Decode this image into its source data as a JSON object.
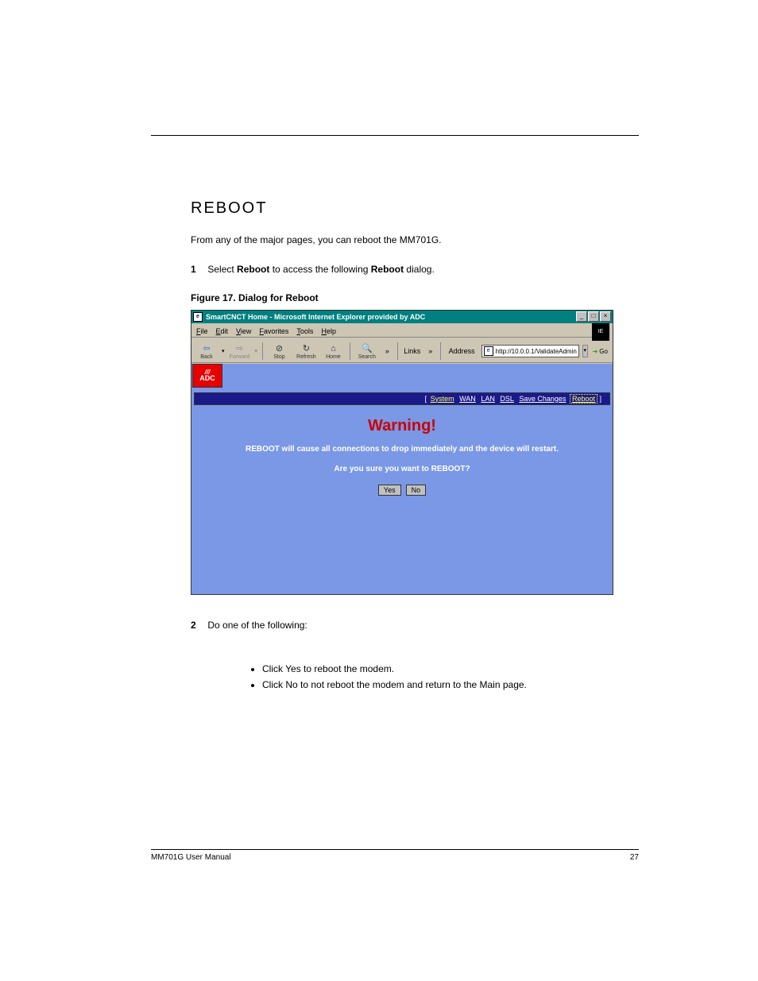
{
  "section_title": "REBOOT",
  "intro_line1": "From any of the major pages, you can reboot the MM701G.",
  "intro_step_prefix": "1",
  "intro_step_text_a": "Select ",
  "intro_step_bold": "Reboot",
  "intro_step_text_b": " to access the following ",
  "intro_step_bold2": "Reboot",
  "intro_step_text_c": " dialog.",
  "figure_caption": "Figure 17.  Dialog for Reboot",
  "browser": {
    "title": "SmartCNCT Home - Microsoft Internet Explorer provided by ADC",
    "menus": [
      "File",
      "Edit",
      "View",
      "Favorites",
      "Tools",
      "Help"
    ],
    "toolbar": {
      "back": "Back",
      "forward": "Forward",
      "stop": "Stop",
      "refresh": "Refresh",
      "home": "Home",
      "search": "Search"
    },
    "links_label": "Links",
    "address_label": "Address",
    "address_value": "http://10.0.0.1/ValidateAdmin",
    "go": "Go"
  },
  "adc_logo": "ADC",
  "nav": {
    "system": "System",
    "wan": "WAN",
    "lan": "LAN",
    "dsl": "DSL",
    "save": "Save Changes",
    "reboot": "Reboot"
  },
  "warning_title": "Warning!",
  "warning_text": "REBOOT will cause all connections to drop immediately and the device will restart.",
  "confirm_text": "Are you sure you want to REBOOT?",
  "yes": "Yes",
  "no": "No",
  "step2_prefix": "2",
  "step2_text": "Do one of the following:",
  "bullet1_a": "Click ",
  "bullet1_bold": "Yes",
  "bullet1_b": " to reboot the modem.",
  "bullet2_a": "Click ",
  "bullet2_bold": "No",
  "bullet2_b": " to not reboot the modem and return to the Main page.",
  "footer_left": "MM701G User Manual",
  "footer_right": "27"
}
